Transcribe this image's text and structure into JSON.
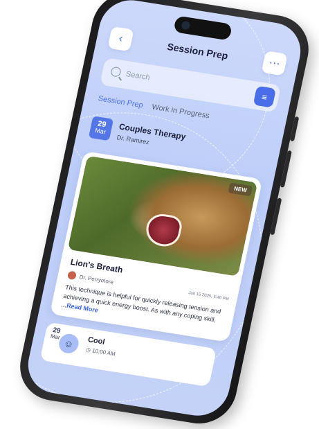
{
  "header": {
    "title": "Session Prep",
    "back_icon": "chevron-left-icon",
    "menu_icon": "more-horizontal-icon"
  },
  "search": {
    "placeholder": "Search",
    "filter_icon": "sliders-icon"
  },
  "tabs": [
    {
      "label": "Session Prep",
      "active": true
    },
    {
      "label": "Work in Progress",
      "active": false
    }
  ],
  "session": {
    "day": "29",
    "month": "Mar",
    "title": "Couples Therapy",
    "subtitle": "Dr. Ramirez"
  },
  "article": {
    "badge": "NEW",
    "title": "Lion's Breath",
    "author": "Dr. Perrymore",
    "timestamp": "Jan 15 2025, 5:40 PM",
    "description": "This technique is helpful for quickly releasing tension and achieving a quick energy boost. As with any coping skill, ...",
    "read_more": "Read More"
  },
  "mood": {
    "day": "29",
    "month": "Mar",
    "label": "Cool",
    "time": "10:00 AM",
    "face_icon": "smile-face-icon"
  },
  "colors": {
    "accent": "#4a6ee8",
    "screen_bg": "#c4d2f7"
  }
}
